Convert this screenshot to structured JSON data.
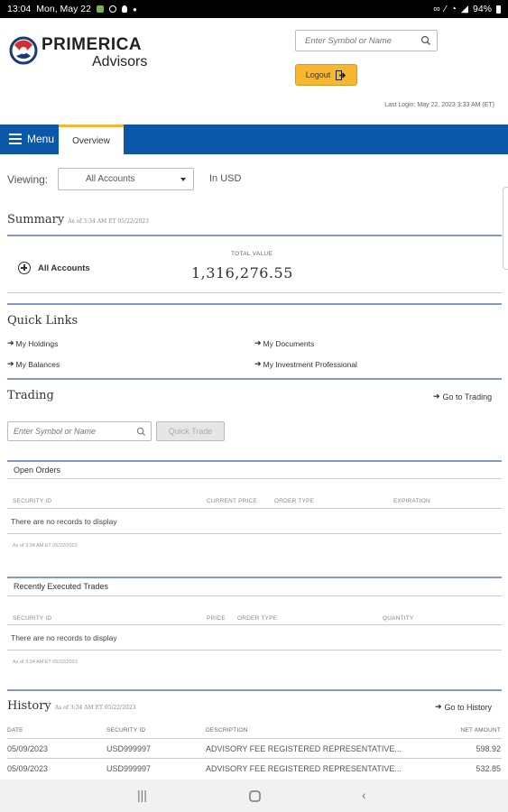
{
  "status_bar": {
    "time": "13:04",
    "date": "Mon, May 22",
    "battery": "94%"
  },
  "header": {
    "brand": "PRIMERICA",
    "brand_sub": "Advisors",
    "search_placeholder": "Enter Symbol or Name",
    "logout_label": "Logout",
    "last_login": "Last Login: May 22, 2023 3:33 AM (ET)"
  },
  "nav": {
    "menu_label": "Menu",
    "tab_overview": "Overview"
  },
  "viewing": {
    "label": "Viewing:",
    "selected_account": "All Accounts",
    "currency": "In USD"
  },
  "summary": {
    "title": "Summary",
    "as_of": "As of 3:34 AM ET 05/22/2023",
    "account_label": "All Accounts",
    "total_value_label": "TOTAL VALUE",
    "total_value": "1,316,276.55"
  },
  "quick_links": {
    "title": "Quick Links",
    "items": [
      "My Holdings",
      "My Documents",
      "My Balances",
      "My Investment Professional"
    ]
  },
  "trading": {
    "title": "Trading",
    "go_link": "Go to Trading",
    "search_placeholder": "Enter Symbol or Name",
    "quick_trade_label": "Quick Trade",
    "open_orders": {
      "title": "Open Orders",
      "columns": [
        "SECURITY ID",
        "CURRENT PRICE",
        "ORDER TYPE",
        "EXPIRATION"
      ],
      "empty": "There are no records to display",
      "as_of": "As of 3:34 AM ET 05/22/2023"
    },
    "recent_trades": {
      "title": "Recently Executed Trades",
      "columns": [
        "SECURITY ID",
        "PRICE",
        "ORDER TYPE",
        "QUANTITY"
      ],
      "empty": "There are no records to display",
      "as_of": "As of 3:34 AM ET 05/22/2023"
    }
  },
  "history": {
    "title": "History",
    "as_of": "As of 3:34 AM ET 05/22/2023",
    "go_link": "Go to History",
    "columns": [
      "DATE",
      "SECURITY ID",
      "DESCRIPTION",
      "NET AMOUNT"
    ],
    "rows": [
      {
        "date": "05/09/2023",
        "security": "USD999997",
        "description": "ADVISORY FEE REGISTERED REPRESENTATIVE...",
        "amount": "598.92"
      },
      {
        "date": "05/09/2023",
        "security": "USD999997",
        "description": "ADVISORY FEE REGISTERED REPRESENTATIVE...",
        "amount": "532.85"
      }
    ]
  },
  "colors": {
    "nav_blue": "#0b58a8",
    "accent_gold": "#f7b731",
    "divider_blue": "#8797c5"
  }
}
